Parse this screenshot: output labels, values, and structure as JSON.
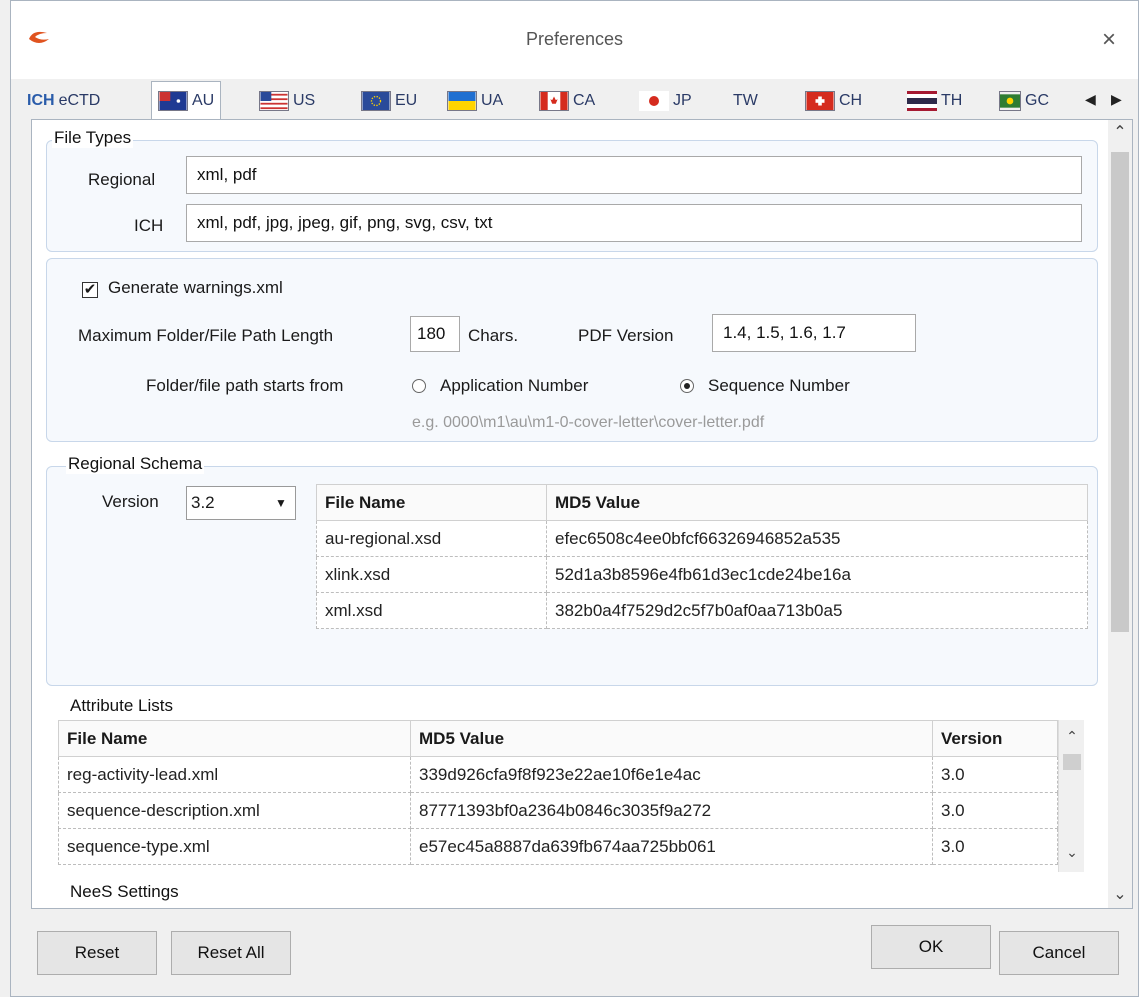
{
  "window": {
    "title": "Preferences"
  },
  "tabs": [
    {
      "label": "eCTD",
      "prefix": "ICH"
    },
    {
      "label": "AU"
    },
    {
      "label": "US"
    },
    {
      "label": "EU"
    },
    {
      "label": "UA"
    },
    {
      "label": "CA"
    },
    {
      "label": "JP"
    },
    {
      "label": "TW"
    },
    {
      "label": "CH"
    },
    {
      "label": "TH"
    },
    {
      "label": "GC"
    }
  ],
  "file_types": {
    "group_label": "File Types",
    "regional_label": "Regional",
    "regional_value": "xml, pdf",
    "ich_label": "ICH",
    "ich_value": "xml, pdf, jpg, jpeg, gif, png, svg, csv, txt"
  },
  "options": {
    "generate_warnings_label": "Generate warnings.xml",
    "generate_warnings_checked": true,
    "max_path_label": "Maximum Folder/File Path Length",
    "max_path_value": "180",
    "chars_label": "Chars.",
    "pdf_version_label": "PDF Version",
    "pdf_version_value": "1.4, 1.5, 1.6, 1.7",
    "path_start_label": "Folder/file path starts from",
    "radio_application": "Application Number",
    "radio_sequence": "Sequence Number",
    "selected": "Sequence Number",
    "example": "e.g. 0000\\m1\\au\\m1-0-cover-letter\\cover-letter.pdf"
  },
  "regional_schema": {
    "group_label": "Regional Schema",
    "version_label": "Version",
    "version_value": "3.2",
    "columns": [
      "File Name",
      "MD5 Value"
    ],
    "rows": [
      [
        "au-regional.xsd",
        "efec6508c4ee0bfcf66326946852a535"
      ],
      [
        "xlink.xsd",
        "52d1a3b8596e4fb61d3ec1cde24be16a"
      ],
      [
        "xml.xsd",
        "382b0a4f7529d2c5f7b0af0aa713b0a5"
      ]
    ]
  },
  "attribute_lists": {
    "group_label": "Attribute Lists",
    "columns": [
      "File Name",
      "MD5 Value",
      "Version"
    ],
    "rows": [
      [
        "reg-activity-lead.xml",
        "339d926cfa9f8f923e22ae10f6e1e4ac",
        "3.0"
      ],
      [
        "sequence-description.xml",
        "87771393bf0a2364b0846c3035f9a272",
        "3.0"
      ],
      [
        "sequence-type.xml",
        "e57ec45a8887da639fb674aa725bb061",
        "3.0"
      ]
    ]
  },
  "nees": {
    "group_label": "NeeS Settings"
  },
  "buttons": {
    "reset": "Reset",
    "reset_all": "Reset All",
    "ok": "OK",
    "cancel": "Cancel"
  },
  "colors": {
    "accent": "#2a5caa",
    "group_border": "#c8d7ea"
  }
}
